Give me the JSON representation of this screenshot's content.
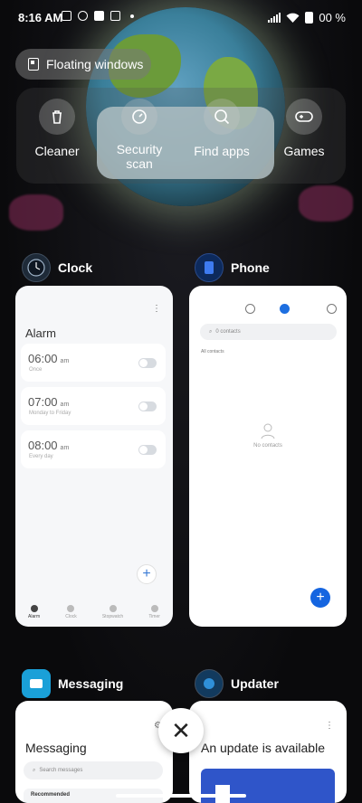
{
  "status": {
    "time": "8:16 AM",
    "battery": "00 %",
    "icons_left": [
      "vibrate-icon",
      "settings-icon",
      "square-icon",
      "app-badge-icon",
      "dot-icon"
    ],
    "icons_right": [
      "signal-icon",
      "wifi-icon",
      "battery-icon"
    ]
  },
  "floating_windows": {
    "label": "Floating windows",
    "icon": "floating-window-icon"
  },
  "quick_actions": [
    {
      "label": "Cleaner",
      "icon": "trash-icon"
    },
    {
      "label": "Security\nscan",
      "icon": "shield-scan-icon"
    },
    {
      "label": "Find apps",
      "icon": "search-apps-icon"
    },
    {
      "label": "Games",
      "icon": "gamepad-icon"
    }
  ],
  "apps": {
    "clock": {
      "name": "Clock",
      "screen_title": "Alarm",
      "alarms": [
        {
          "time": "06:00",
          "ampm": "am",
          "sub": "Once"
        },
        {
          "time": "07:00",
          "ampm": "am",
          "sub": "Monday to Friday"
        },
        {
          "time": "08:00",
          "ampm": "am",
          "sub": "Every day"
        }
      ],
      "fab": "+",
      "nav": [
        "Alarm",
        "Clock",
        "Stopwatch",
        "Timer"
      ]
    },
    "phone": {
      "name": "Phone",
      "search_placeholder": "0 contacts",
      "all_contacts": "All contacts",
      "empty": "No contacts",
      "fab": "+"
    },
    "messaging": {
      "name": "Messaging",
      "screen_title": "Messaging",
      "search_placeholder": "Search messages",
      "recommended": "Recommended"
    },
    "updater": {
      "name": "Updater",
      "screen_title": "An update is available"
    }
  },
  "close_symbol": "✕"
}
